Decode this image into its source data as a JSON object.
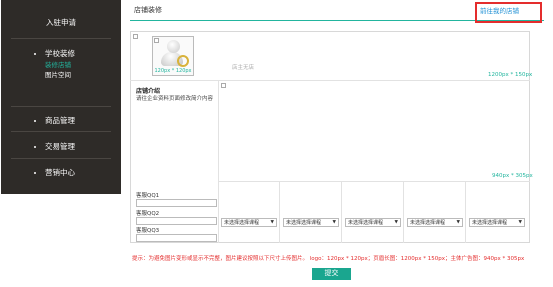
{
  "sidebar": {
    "entry_label": "入驻申请",
    "groups": [
      {
        "label": "学校装修",
        "subitems": [
          "装修店铺",
          "图片空间"
        ],
        "active_index": 0
      },
      {
        "label": "商品管理"
      },
      {
        "label": "交易管理"
      },
      {
        "label": "营销中心"
      }
    ]
  },
  "header": {
    "title": "店铺装修",
    "goto_store_link": "前往我的店铺"
  },
  "banner": {
    "logo_size": "120px * 120px",
    "no_store_text": "店主无店",
    "banner_size": "1200px * 150px"
  },
  "intro": {
    "title": "店铺介绍",
    "text": "请往企业资料页面修改简介内容"
  },
  "ad": {
    "size": "940px * 305px"
  },
  "qq": {
    "labels": [
      "客服QQ1",
      "客服QQ2",
      "客服QQ3"
    ],
    "values": [
      "",
      "",
      ""
    ]
  },
  "courses": {
    "selects": [
      "未选择选择课程",
      "未选择选择课程",
      "未选择选择课程",
      "未选择选择课程",
      "未选择选择课程"
    ]
  },
  "tip": "提示：为避免图片变形或显示不完整，图片建议按照以下尺寸上传图片。 logo：120px * 120px；页眉长图：1200px * 150px；主体广告图：940px * 305px",
  "submit_label": "提交",
  "colors": {
    "accent": "#22b59e",
    "highlight": "#e42d2d",
    "sidebar_bg": "#2e2b28"
  }
}
